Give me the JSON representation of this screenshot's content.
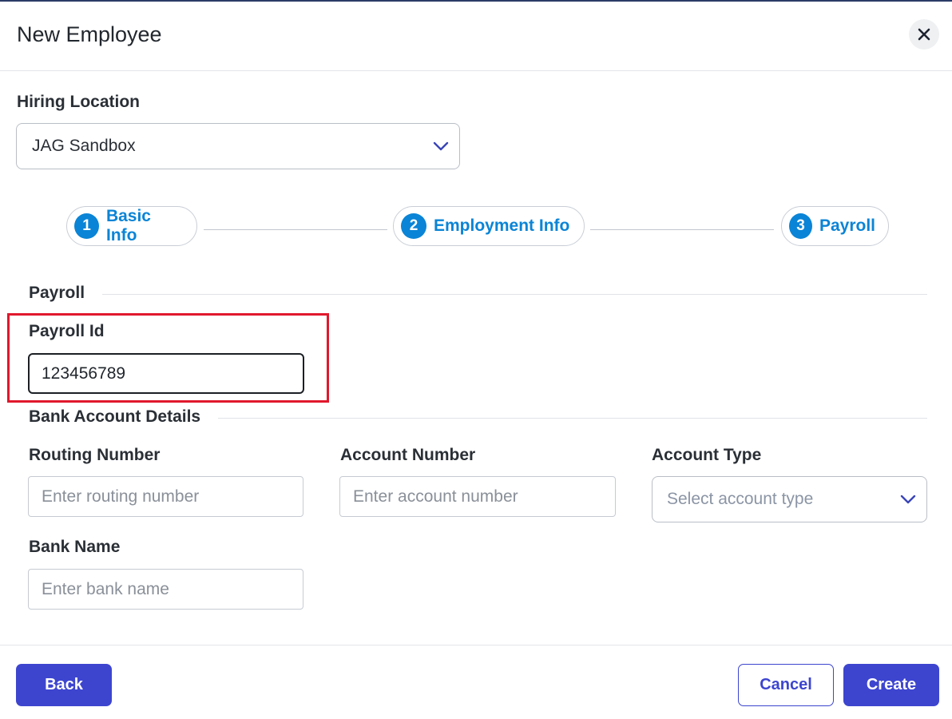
{
  "dialog": {
    "title": "New Employee"
  },
  "hiring_location": {
    "label": "Hiring Location",
    "value": "JAG Sandbox"
  },
  "steps": [
    {
      "number": "1",
      "label": "Basic Info"
    },
    {
      "number": "2",
      "label": "Employment Info"
    },
    {
      "number": "3",
      "label": "Payroll"
    }
  ],
  "payroll_section": {
    "title": "Payroll",
    "payroll_id_label": "Payroll Id",
    "payroll_id_value": "123456789"
  },
  "bank_section": {
    "title": "Bank Account Details",
    "routing_label": "Routing Number",
    "routing_placeholder": "Enter routing number",
    "account_number_label": "Account Number",
    "account_number_placeholder": "Enter account number",
    "account_type_label": "Account Type",
    "account_type_placeholder": "Select account type",
    "bank_name_label": "Bank Name",
    "bank_name_placeholder": "Enter bank name"
  },
  "footer": {
    "back_label": "Back",
    "cancel_label": "Cancel",
    "create_label": "Create"
  },
  "colors": {
    "accent_step": "#0a84d6",
    "primary_button": "#3d45cf",
    "highlight_box": "#e0182d"
  },
  "icons": {
    "close": "close-icon",
    "dropdown": "chevron-down-icon"
  }
}
